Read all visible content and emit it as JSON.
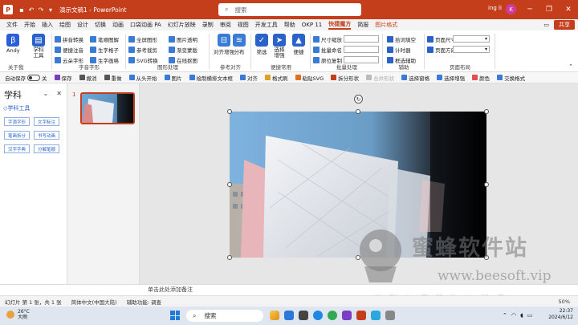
{
  "titlebar": {
    "doc_title": "演示文稿1 - PowerPoint",
    "search_placeholder": "搜索",
    "user_name": "ing li",
    "avatar_initial": "K"
  },
  "menu": {
    "tabs": [
      "文件",
      "开始",
      "插入",
      "绘图",
      "设计",
      "切换",
      "动画",
      "口袋动画 PA",
      "幻灯片放映",
      "录制",
      "审阅",
      "视图",
      "开发工具",
      "帮助",
      "OKP 11",
      "快捷魔方",
      "简报",
      "图片格式"
    ],
    "share_label": "共享"
  },
  "ribbon": {
    "andy": "Andy",
    "xueke_tool": "学科\n工具",
    "about_me": "关于我",
    "zimu": {
      "items": [
        "拼音转换",
        "笔顺图解",
        "便捷注音",
        "生字格子",
        "云朵字形",
        "生字画格"
      ],
      "group": "字音字形"
    },
    "tuxing": {
      "items": [
        "全屏图形",
        "图片透明",
        "参考裁剪",
        "渐变蒙版",
        "SVG转换",
        "在线抠图"
      ],
      "group": "图形处理"
    },
    "duiqi": {
      "a": "对齐增强",
      "b": "分布",
      "group": "参考对齐"
    },
    "bianjie": {
      "a": "筛选",
      "b": "选择\n增强",
      "c": "便捷",
      "group": "便捷常用"
    },
    "piliang": {
      "items": [
        "尺寸缩放",
        "批量命名",
        "原位复制"
      ],
      "group": "批量处理"
    },
    "fuzhu": {
      "items": [
        "拾词填空",
        "计时器",
        "框选辅助"
      ],
      "group": "辅助"
    },
    "yemian": {
      "items": [
        "页面尺寸",
        "页面方向"
      ],
      "group": "页面布局"
    }
  },
  "toolbar2": {
    "autosave": "自动保存",
    "autosave_state": "关",
    "items": [
      "保存",
      "撤消",
      "重做",
      "从头开始",
      "图片",
      "绘制横排文本框",
      "对齐",
      "格式刷",
      "粘贴SVG",
      "拆分形状",
      "合并形状",
      "选择窗格",
      "选择增强",
      "颜色",
      "交换格式"
    ]
  },
  "leftpanel": {
    "title": "学科",
    "tool_link": "◇学科工具",
    "pills": [
      "字源字形",
      "文字标注",
      "笔画拆分",
      "书写动画",
      "汉字字典",
      "分解笔顺"
    ]
  },
  "slides": {
    "current_number": "1"
  },
  "notes": {
    "placeholder": "单击此处添加备注"
  },
  "status": {
    "slide_info": "幻灯片 第 1 张，共 1 张",
    "language": "简体中文(中国大陆)",
    "accessibility": "辅助功能: 调查",
    "zoom": "50%"
  },
  "watermark": {
    "name": "蜜蜂软件站",
    "url": "www.beesoft.vip",
    "slogan": "互联網優質資源搬運工"
  },
  "taskbar": {
    "temperature": "26°C",
    "weather": "大雨",
    "search_label": "搜索",
    "time": "22:37",
    "date": "2024/6/12"
  },
  "colors": {
    "accent": "#c43e1c",
    "link_blue": "#2a62c9"
  }
}
